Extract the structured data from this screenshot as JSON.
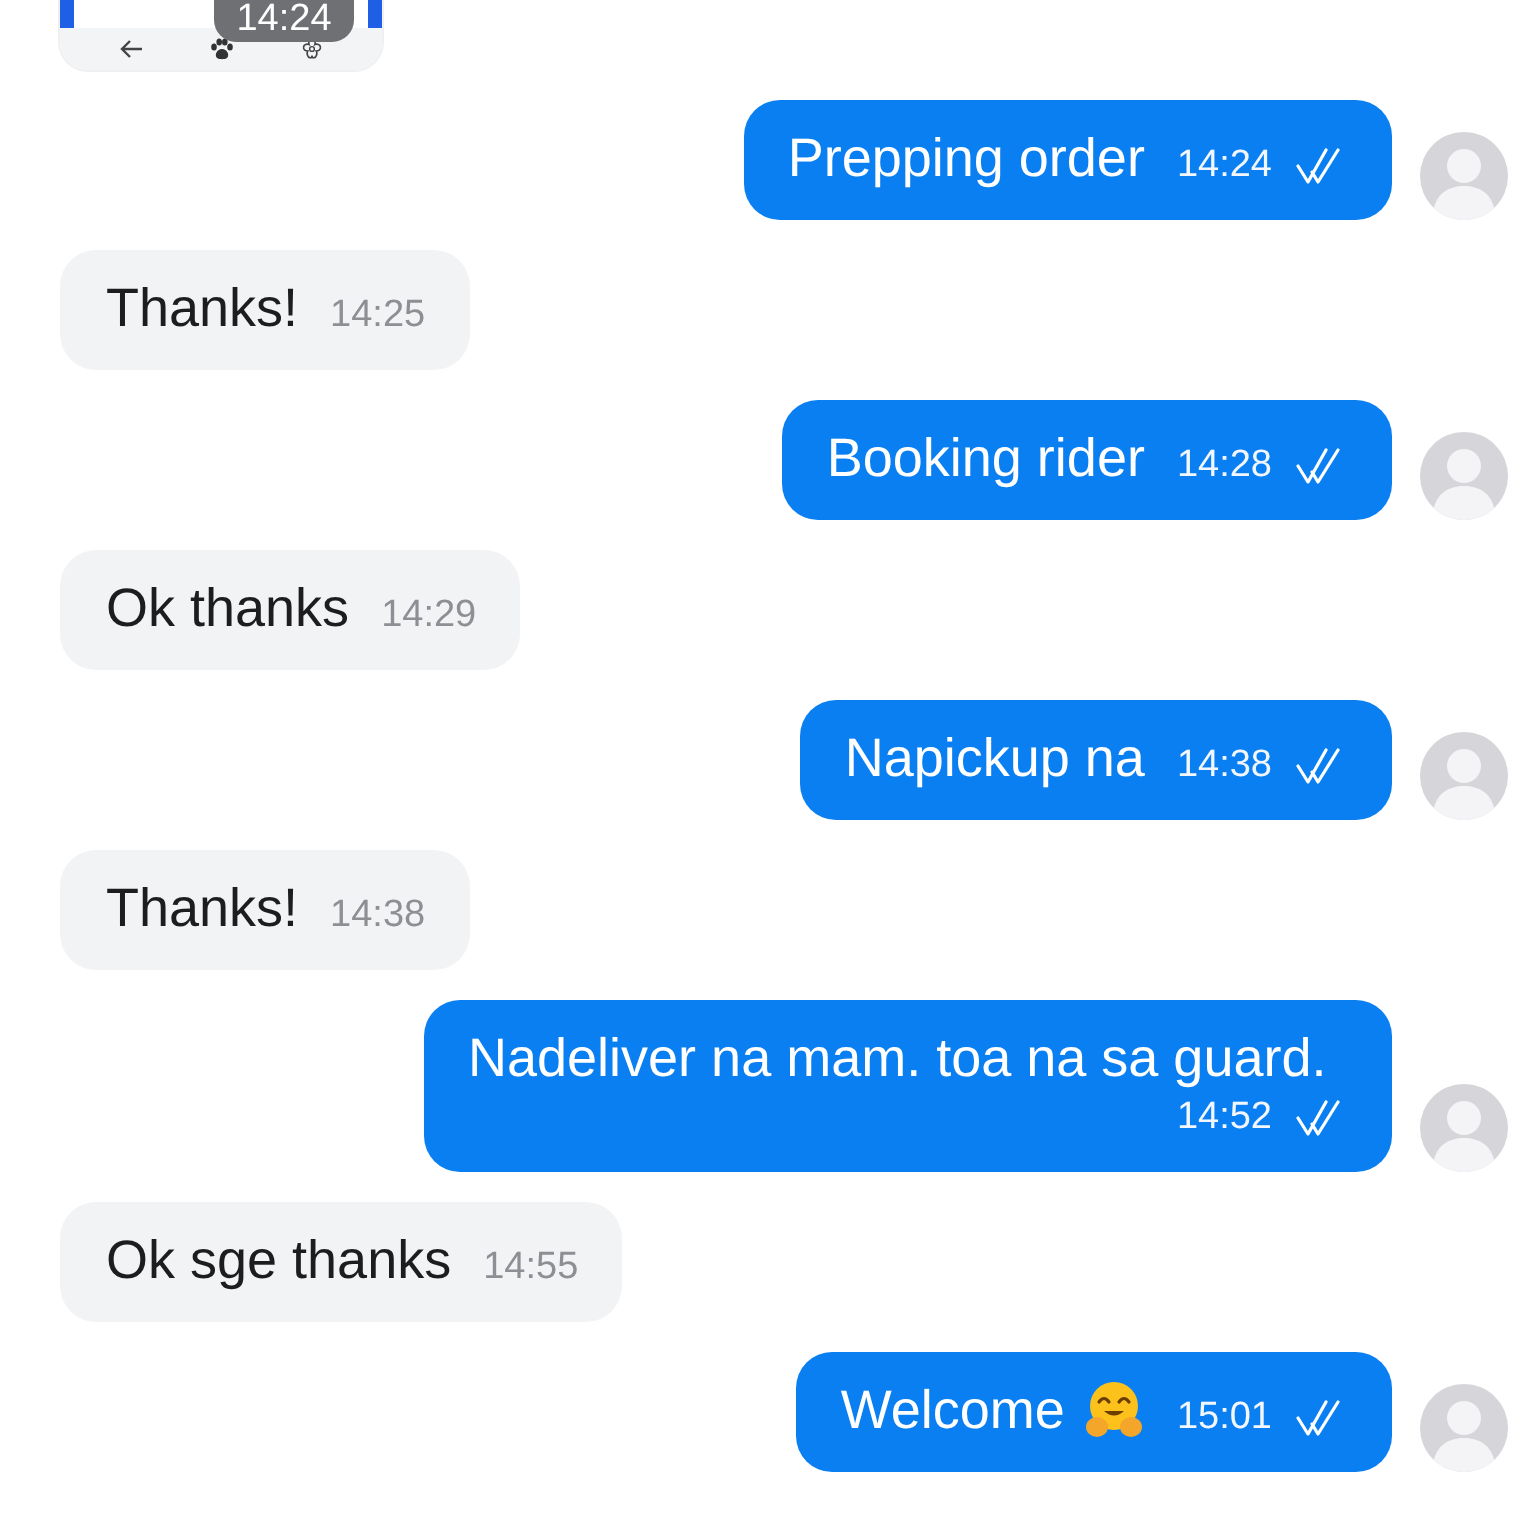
{
  "messages": [
    {
      "kind": "image",
      "time": "14:24"
    },
    {
      "kind": "text",
      "outgoing": true,
      "text": "Prepping order",
      "emoji": false,
      "time": "14:24",
      "read": true
    },
    {
      "kind": "text",
      "outgoing": false,
      "text": "Thanks!",
      "emoji": false,
      "time": "14:25"
    },
    {
      "kind": "text",
      "outgoing": true,
      "text": "Booking rider",
      "emoji": false,
      "time": "14:28",
      "read": true
    },
    {
      "kind": "text",
      "outgoing": false,
      "text": "Ok thanks",
      "emoji": false,
      "time": "14:29"
    },
    {
      "kind": "text",
      "outgoing": true,
      "text": "Napickup na",
      "emoji": false,
      "time": "14:38",
      "read": true
    },
    {
      "kind": "text",
      "outgoing": false,
      "text": "Thanks!",
      "emoji": false,
      "time": "14:38"
    },
    {
      "kind": "text",
      "outgoing": true,
      "text": "Nadeliver na mam. toa na sa guard.",
      "emoji": false,
      "time": "14:52",
      "read": true
    },
    {
      "kind": "text",
      "outgoing": false,
      "text": "Ok sge thanks",
      "emoji": false,
      "time": "14:55"
    },
    {
      "kind": "text",
      "outgoing": true,
      "text": "Welcome",
      "emoji": true,
      "time": "15:01",
      "read": true
    }
  ]
}
